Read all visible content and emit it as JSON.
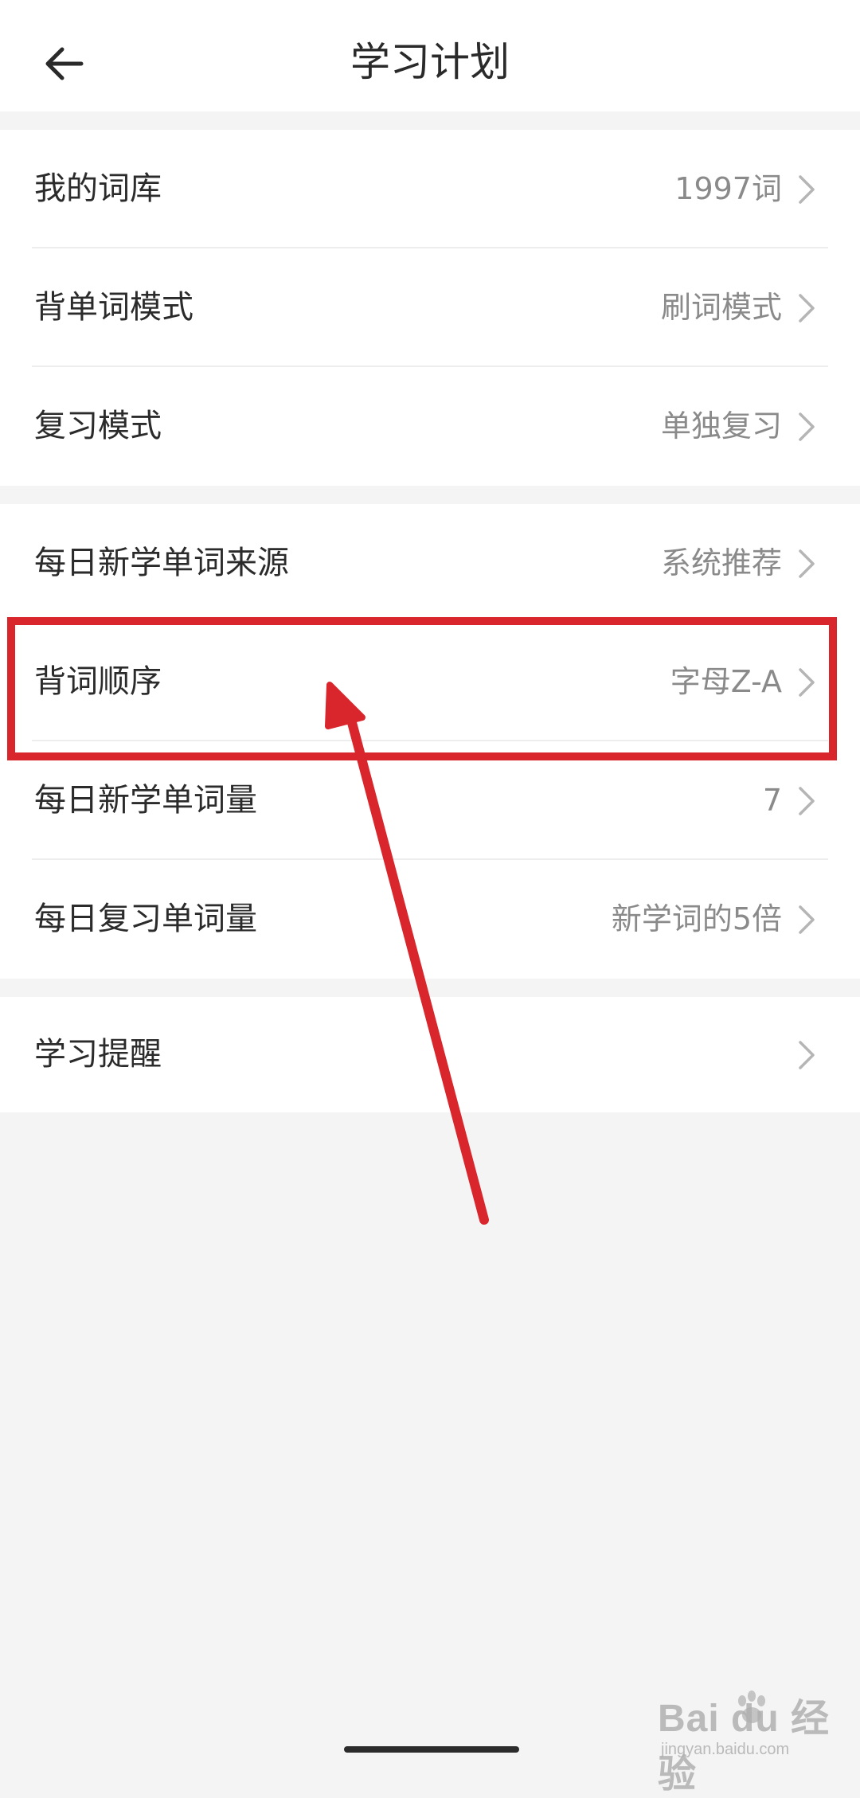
{
  "header": {
    "title": "学习计划",
    "back_icon": "back-arrow-icon"
  },
  "groups": [
    {
      "rows": [
        {
          "label": "我的词库",
          "value": "1997词"
        },
        {
          "label": "背单词模式",
          "value": "刷词模式"
        },
        {
          "label": "复习模式",
          "value": "单独复习"
        }
      ]
    },
    {
      "rows": [
        {
          "label": "每日新学单词来源",
          "value": "系统推荐"
        },
        {
          "label": "背词顺序",
          "value": "字母Z-A"
        },
        {
          "label": "每日新学单词量",
          "value": "7"
        },
        {
          "label": "每日复习单词量",
          "value": "新学词的5倍"
        }
      ]
    },
    {
      "rows": [
        {
          "label": "学习提醒",
          "value": ""
        }
      ]
    }
  ],
  "annotation": {
    "color": "#d8262c",
    "highlighted_row": "背词顺序"
  },
  "watermark": {
    "main": "Bai du 经验",
    "sub": "jingyan.baidu.com"
  },
  "colors": {
    "background": "#f4f4f4",
    "card": "#ffffff",
    "label_text": "#2b2b2b",
    "value_text": "#8a8a8a",
    "annotation_red": "#d8262c"
  }
}
